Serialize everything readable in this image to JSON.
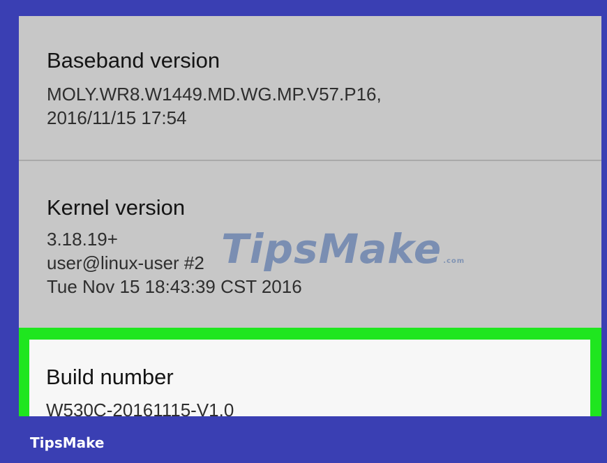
{
  "settings": {
    "baseband": {
      "title": "Baseband version",
      "value": "MOLY.WR8.W1449.MD.WG.MP.V57.P16,\n2016/11/15 17:54"
    },
    "kernel": {
      "title": "Kernel version",
      "value": "3.18.19+\nuser@linux-user #2\nTue Nov 15 18:43:39 CST 2016"
    },
    "build": {
      "title": "Build number",
      "value": "W530C-20161115-V1.0"
    }
  },
  "watermark": {
    "text": "TipsMake",
    "tld": ".com"
  },
  "brand": "TipsMake",
  "colors": {
    "frame": "#3a3fb3",
    "screen_bg": "#c7c7c7",
    "highlight": "#1fe61f",
    "highlight_bg": "#f7f7f7"
  }
}
